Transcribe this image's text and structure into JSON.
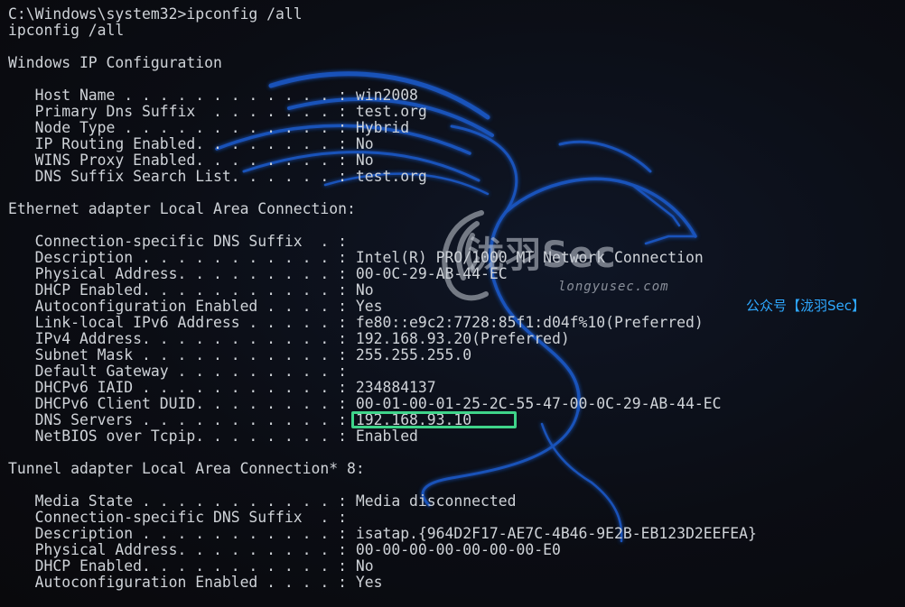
{
  "terminal": {
    "lines": [
      "C:\\Windows\\system32>ipconfig /all",
      "ipconfig /all",
      "",
      "Windows IP Configuration",
      "",
      "   Host Name . . . . . . . . . . . . : win2008",
      "   Primary Dns Suffix  . . . . . . . : test.org",
      "   Node Type . . . . . . . . . . . . : Hybrid",
      "   IP Routing Enabled. . . . . . . . : No",
      "   WINS Proxy Enabled. . . . . . . . : No",
      "   DNS Suffix Search List. . . . . . : test.org",
      "",
      "Ethernet adapter Local Area Connection:",
      "",
      "   Connection-specific DNS Suffix  . :",
      "   Description . . . . . . . . . . . : Intel(R) PRO/1000 MT Network Connection",
      "   Physical Address. . . . . . . . . : 00-0C-29-AB-44-EC",
      "   DHCP Enabled. . . . . . . . . . . : No",
      "   Autoconfiguration Enabled . . . . : Yes",
      "   Link-local IPv6 Address . . . . . : fe80::e9c2:7728:85f1:d04f%10(Preferred)",
      "   IPv4 Address. . . . . . . . . . . : 192.168.93.20(Preferred)",
      "   Subnet Mask . . . . . . . . . . . : 255.255.255.0",
      "   Default Gateway . . . . . . . . . :",
      "   DHCPv6 IAID . . . . . . . . . . . : 234884137",
      "   DHCPv6 Client DUID. . . . . . . . : 00-01-00-01-25-2C-55-47-00-0C-29-AB-44-EC",
      "   DNS Servers . . . . . . . . . . . : 192.168.93.10",
      "   NetBIOS over Tcpip. . . . . . . . : Enabled",
      "",
      "Tunnel adapter Local Area Connection* 8:",
      "",
      "   Media State . . . . . . . . . . . : Media disconnected",
      "   Connection-specific DNS Suffix  . :",
      "   Description . . . . . . . . . . . : isatap.{964D2F17-AE7C-4B46-9E2B-EB123D2EEFEA}",
      "   Physical Address. . . . . . . . . : 00-00-00-00-00-00-00-E0",
      "   DHCP Enabled. . . . . . . . . . . : No",
      "   Autoconfiguration Enabled . . . . : Yes"
    ]
  },
  "watermark": {
    "brand": "泷羽Sec",
    "domain": "longyusec.com",
    "wechat_tag": "公众号【泷羽Sec】"
  },
  "colors": {
    "text": "#cfd3d8",
    "background": "#0c0c0f",
    "dragon": "#1f5fd6",
    "highlight": "#3fd48a",
    "wechat": "#2ea8ff"
  }
}
